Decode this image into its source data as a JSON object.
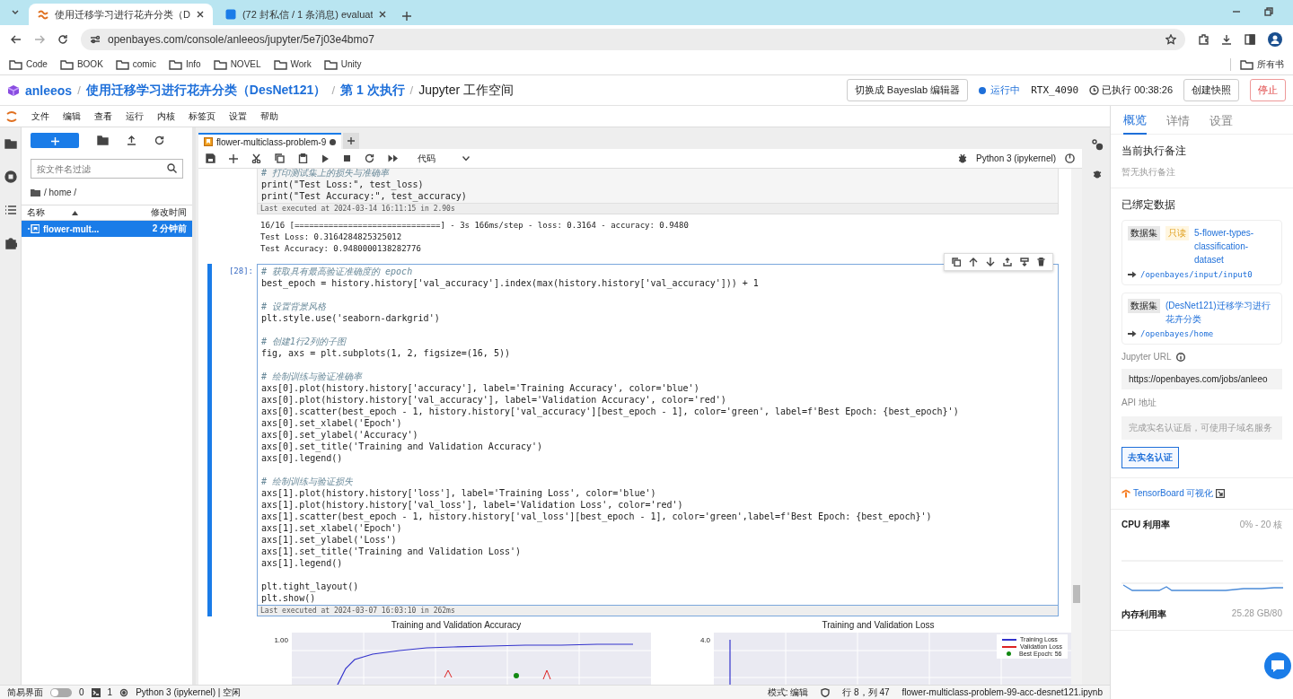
{
  "browser": {
    "tabs": [
      {
        "title": "使用迁移学习进行花卉分类（D",
        "selected": true
      },
      {
        "title": "(72 封私信 / 1 条消息) evaluat",
        "selected": false
      }
    ],
    "address": "openbayes.com/console/anleeos/jupyter/5e7j03e4bmo7",
    "bookmarks": [
      "Code",
      "BOOK",
      "comic",
      "Info",
      "NOVEL",
      "Work",
      "Unity"
    ],
    "bookmarks_overflow": "所有书"
  },
  "header": {
    "separator": "/",
    "breadcrumb": [
      {
        "text": "anleeos",
        "current": false
      },
      {
        "text": "使用迁移学习进行花卉分类（DesNet121）",
        "current": false
      },
      {
        "text": "第 1 次执行",
        "current": false
      },
      {
        "text": "Jupyter 工作空间",
        "current": true
      }
    ],
    "switch_button": "切换成 Bayeslab 编辑器",
    "status": "运行中",
    "gpu": "RTX_4090",
    "elapsed": "已执行 00:38:26",
    "snapshot_button": "创建快照",
    "stop_button": "停止"
  },
  "menu": [
    "文件",
    "编辑",
    "查看",
    "运行",
    "内核",
    "标签页",
    "设置",
    "帮助"
  ],
  "file_browser": {
    "filter_placeholder": "按文件名过滤",
    "path": "/ home /",
    "columns": [
      "名称",
      "修改时间"
    ],
    "files": [
      {
        "name": "flower-mult...",
        "modified": "2 分钟前",
        "selected": true
      }
    ]
  },
  "notebook": {
    "tabs": [
      {
        "title": "flower-multiclass-problem-9",
        "unsaved": true,
        "selected": true
      }
    ],
    "cell_type": "代码",
    "kernel": "Python 3 (ipykernel)",
    "cells": [
      {
        "selected": false,
        "blocks": [
          [
            {
              "kind": "comment",
              "text": "# 打印测试集上的损失与准确率"
            },
            {
              "kind": "code",
              "text": "print(\"Test Loss:\", test_loss)"
            },
            {
              "kind": "code",
              "text": "print(\"Test Accuracy:\", test_accuracy)"
            }
          ]
        ],
        "executed": "Last executed at 2024-03-14 16:11:15 in 2.90s",
        "output": [
          "16/16 [==============================] - 3s 166ms/step - loss: 0.3164 - accuracy: 0.9480",
          "Test Loss: 0.3164284825325012",
          "Test Accuracy: 0.9480000138282776"
        ]
      },
      {
        "prompt": "[28]:",
        "selected": true,
        "blocks": [
          [
            {
              "kind": "comment",
              "text": "# 获取具有最高验证准确度的 epoch"
            },
            {
              "kind": "code",
              "text": "best_epoch = history.history['val_accuracy'].index(max(history.history['val_accuracy'])) + 1"
            }
          ],
          [
            {
              "kind": "comment",
              "text": "# 设置背景风格"
            },
            {
              "kind": "code",
              "text": "plt.style.use('seaborn-darkgrid')"
            }
          ],
          [
            {
              "kind": "comment",
              "text": "# 创建1行2列的子图"
            },
            {
              "kind": "code",
              "text": "fig, axs = plt.subplots(1, 2, figsize=(16, 5))"
            }
          ],
          [
            {
              "kind": "comment",
              "text": "# 绘制训练与验证准确率"
            },
            {
              "kind": "code",
              "text": "axs[0].plot(history.history['accuracy'], label='Training Accuracy', color='blue')"
            },
            {
              "kind": "code",
              "text": "axs[0].plot(history.history['val_accuracy'], label='Validation Accuracy', color='red')"
            },
            {
              "kind": "code",
              "text": "axs[0].scatter(best_epoch - 1, history.history['val_accuracy'][best_epoch - 1], color='green', label=f'Best Epoch: {best_epoch}')"
            },
            {
              "kind": "code",
              "text": "axs[0].set_xlabel('Epoch')"
            },
            {
              "kind": "code",
              "text": "axs[0].set_ylabel('Accuracy')"
            },
            {
              "kind": "code",
              "text": "axs[0].set_title('Training and Validation Accuracy')"
            },
            {
              "kind": "code",
              "text": "axs[0].legend()"
            }
          ],
          [
            {
              "kind": "comment",
              "text": "# 绘制训练与验证损失"
            },
            {
              "kind": "code",
              "text": "axs[1].plot(history.history['loss'], label='Training Loss', color='blue')"
            },
            {
              "kind": "code",
              "text": "axs[1].plot(history.history['val_loss'], label='Validation Loss', color='red')"
            },
            {
              "kind": "code",
              "text": "axs[1].scatter(best_epoch - 1, history.history['val_loss'][best_epoch - 1], color='green',label=f'Best Epoch: {best_epoch}')"
            },
            {
              "kind": "code",
              "text": "axs[1].set_xlabel('Epoch')"
            },
            {
              "kind": "code",
              "text": "axs[1].set_ylabel('Loss')"
            },
            {
              "kind": "code",
              "text": "axs[1].set_title('Training and Validation Loss')"
            },
            {
              "kind": "code",
              "text": "axs[1].legend()"
            }
          ],
          [
            {
              "kind": "code",
              "text": "plt.tight_layout()"
            },
            {
              "kind": "code",
              "text": "plt.show()"
            }
          ]
        ],
        "executed": "Last executed at 2024-03-07 16:03:10 in 262ms"
      }
    ],
    "figures": [
      {
        "title": "Training and Validation Accuracy",
        "tick": "1.00"
      },
      {
        "title": "Training and Validation Loss",
        "tick": "4.0",
        "legend": [
          {
            "label": "Training Loss",
            "kind": "line",
            "color": "#3333cc"
          },
          {
            "label": "Validation Loss",
            "kind": "line",
            "color": "#dd2222"
          },
          {
            "label": "Best Epoch: 56",
            "kind": "dot",
            "color": "#118811"
          }
        ]
      }
    ]
  },
  "right_panel": {
    "tabs": [
      {
        "label": "概览",
        "selected": true
      },
      {
        "label": "详情",
        "selected": false
      },
      {
        "label": "设置",
        "selected": false
      }
    ],
    "note_title": "当前执行备注",
    "note": "暂无执行备注",
    "bound_title": "已绑定数据",
    "datasets": [
      {
        "badge": "数据集",
        "readonly": "只读",
        "name": "5-flower-types-classification-dataset",
        "path": "/openbayes/input/input0"
      },
      {
        "badge": "数据集",
        "name": "(DesNet121)迁移学习进行花卉分类",
        "path": "/openbayes/home"
      }
    ],
    "jupyter_url_label": "Jupyter URL",
    "jupyter_url": "https://openbayes.com/jobs/anleeo",
    "api_label": "API 地址",
    "api_value": "完成实名认证后，可使用子域名服务",
    "verify_button": "去实名认证",
    "tensorboard": "TensorBoard 可视化",
    "cpu_label": "CPU 利用率",
    "cpu_range": "0% - 20 核",
    "mem_label": "内存利用率",
    "mem_value": "25.28 GB/80"
  },
  "status_bar": {
    "simple_mode": {
      "label": "简易界面",
      "on": false
    },
    "terminals": "0",
    "kernels": "1",
    "kernel_status": "Python 3 (ipykernel) | 空闲",
    "mode": "模式: 编辑",
    "cursor": "行 8，列 47",
    "file": "flower-multiclass-problem-99-acc-desnet121.ipynb"
  }
}
